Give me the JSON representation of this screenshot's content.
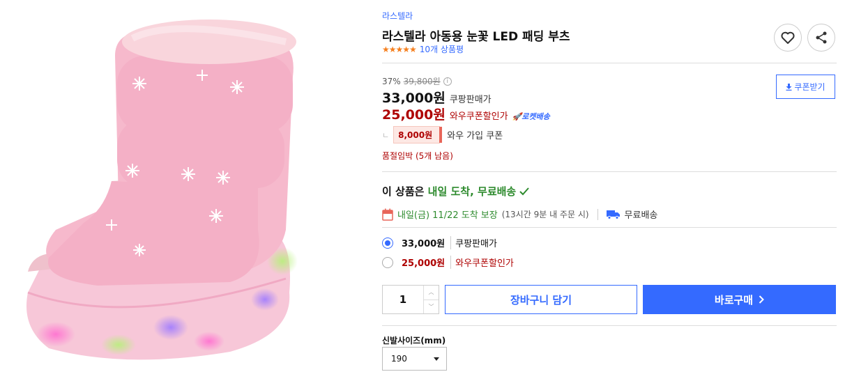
{
  "product": {
    "brand": "라스텔라",
    "title": "라스텔라 아동용 눈꽃 LED 패딩 부츠",
    "stars": "★★★★★",
    "review_count": "10개 상품평"
  },
  "pricing": {
    "discount_rate": "37%",
    "original_price": "39,800원",
    "info_glyph": "i",
    "sale_price": "33,000원",
    "sale_label": "쿠팡판매가",
    "wow_price": "25,000원",
    "wow_label": "와우쿠폰할인가",
    "rocket_label": "로켓배송",
    "coupon_indent": "ㄴ",
    "coupon_amount": "8,000원",
    "coupon_text": "와우 가입 쿠폰",
    "stock_notice": "품절임박 (5개 남음)",
    "coupon_button": "쿠폰받기"
  },
  "delivery": {
    "headline_prefix": "이 상품은",
    "headline_highlight": "내일 도착, 무료배송",
    "arrival": "내일(금) 11/22 도착 보장",
    "arrival_note": "(13시간 9분 내 주문 시)",
    "free_shipping": "무료배송"
  },
  "options": [
    {
      "price": "33,000원",
      "label": "쿠팡판매가",
      "selected": true
    },
    {
      "price": "25,000원",
      "label": "와우쿠폰할인가",
      "selected": false
    }
  ],
  "purchase": {
    "quantity": "1",
    "cart_button": "장바구니 담기",
    "buy_button": "바로구매"
  },
  "size": {
    "label": "신발사이즈(mm)",
    "selected": "190"
  },
  "colors": {
    "accent": "#346aff",
    "wow_red": "#ae0000",
    "delivery_green": "#2e8b2e",
    "star_orange": "#f57f1e"
  },
  "icons": {
    "wishlist": "heart-icon",
    "share": "share-icon",
    "download": "download-icon",
    "calendar": "calendar-icon",
    "truck": "truck-icon",
    "check": "check-icon",
    "chevron": "chevron-right-icon"
  }
}
